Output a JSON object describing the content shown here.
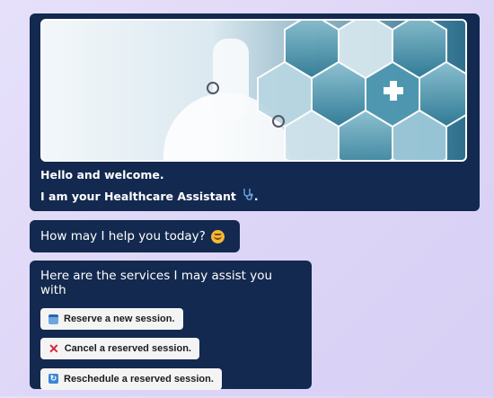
{
  "welcome": {
    "line1": "Hello and welcome.",
    "line2": "I am your Healthcare Assistant",
    "line2_end": ".",
    "banner_icon": "healthcare-collage-image",
    "stethoscope_icon": "stethoscope-icon"
  },
  "help": {
    "text": "How may I help you today?",
    "emoji": "smiling-face-icon"
  },
  "services": {
    "title": "Here are the services I may assist you with",
    "buttons": [
      {
        "label": "Reserve a new session.",
        "icon": "calendar-icon"
      },
      {
        "label": "Cancel a reserved session.",
        "icon": "cross-mark-icon"
      },
      {
        "label": "Reschedule a reserved session.",
        "icon": "repeat-icon"
      }
    ]
  },
  "colors": {
    "bubble": "#13294f",
    "background": "#e2dcf8",
    "button": "#f4f4f4",
    "cancel": "#d6243b",
    "accent": "#3b86d8"
  }
}
